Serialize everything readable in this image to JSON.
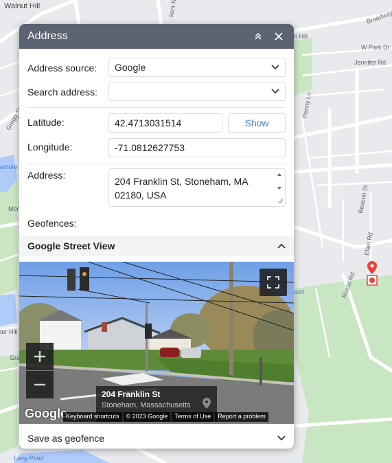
{
  "map": {
    "labels": {
      "walnut_hill": "Walnut Hill",
      "broadway": "Broadway",
      "w_park_dr": "W Park Dr",
      "jennifer_rd": "Jennifer Rd",
      "penny_ln": "Penny Ln",
      "beacon_st": "Beacon St",
      "ellen_rd": "Ellen Rd",
      "rustic_rd": "Rustic Rd",
      "pond": "ond",
      "gregg": "Gregg St",
      "emore": "emore",
      "mor": "Mor",
      "ter_hill": "ter Hill",
      "gra": "Gra",
      "long_pond": "Long Pond",
      "nhill": "n Hill",
      "konrd": "konr Rd"
    },
    "colors": {
      "water": "#aecbfa",
      "park": "#c9e6c2",
      "road": "#ffffff",
      "pin": "#ea4335"
    }
  },
  "dialog": {
    "title": "Address",
    "collapse_icon": "double-chevron-up-icon",
    "close_icon": "close-icon",
    "address_source": {
      "label": "Address source:",
      "value": "Google"
    },
    "search_address": {
      "label": "Search address:",
      "value": ""
    },
    "latitude": {
      "label": "Latitude:",
      "value": "42.4713031514"
    },
    "show_button": "Show",
    "longitude": {
      "label": "Longitude:",
      "value": "-71.0812627753"
    },
    "address": {
      "label": "Address:",
      "value": "204 Franklin St, Stoneham, MA 02180, USA"
    },
    "geofences": {
      "label": "Geofences:"
    },
    "street_view_section": "Google Street View",
    "street_view": {
      "street": "204 Franklin St",
      "city": "Stoneham, Massachusetts",
      "google_logo": "Google",
      "footer": [
        "Keyboard shortcuts",
        "© 2023 Google",
        "Terms of Use",
        "Report a problem"
      ]
    },
    "save_geofence": "Save as geofence"
  }
}
